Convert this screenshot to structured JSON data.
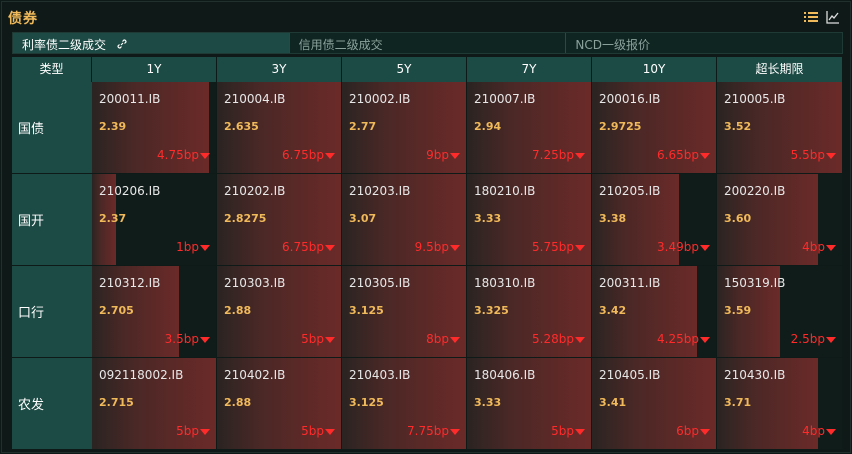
{
  "header": {
    "title": "债券"
  },
  "tabs": [
    {
      "label": "利率债二级成交",
      "active": true
    },
    {
      "label": "信用债二级成交",
      "active": false
    },
    {
      "label": "NCD一级报价",
      "active": false
    }
  ],
  "columns": [
    "类型",
    "1Y",
    "3Y",
    "5Y",
    "7Y",
    "10Y",
    "超长期限"
  ],
  "rows": [
    {
      "label": "国债",
      "cells": [
        {
          "code": "200011.IB",
          "yield": "2.39",
          "change": "4.75bp",
          "fill": 0.94
        },
        {
          "code": "210004.IB",
          "yield": "2.635",
          "change": "6.75bp",
          "fill": 1.0
        },
        {
          "code": "210002.IB",
          "yield": "2.77",
          "change": "9bp",
          "fill": 1.0
        },
        {
          "code": "210007.IB",
          "yield": "2.94",
          "change": "7.25bp",
          "fill": 1.0
        },
        {
          "code": "200016.IB",
          "yield": "2.9725",
          "change": "6.65bp",
          "fill": 1.0
        },
        {
          "code": "210005.IB",
          "yield": "3.52",
          "change": "5.5bp",
          "fill": 1.0
        }
      ]
    },
    {
      "label": "国开",
      "cells": [
        {
          "code": "210206.IB",
          "yield": "2.37",
          "change": "1bp",
          "fill": 0.19
        },
        {
          "code": "210202.IB",
          "yield": "2.8275",
          "change": "6.75bp",
          "fill": 1.0
        },
        {
          "code": "210203.IB",
          "yield": "3.07",
          "change": "9.5bp",
          "fill": 1.0
        },
        {
          "code": "180210.IB",
          "yield": "3.33",
          "change": "5.75bp",
          "fill": 1.0
        },
        {
          "code": "210205.IB",
          "yield": "3.38",
          "change": "3.49bp",
          "fill": 0.7
        },
        {
          "code": "200220.IB",
          "yield": "3.60",
          "change": "4bp",
          "fill": 0.81
        }
      ]
    },
    {
      "label": "口行",
      "cells": [
        {
          "code": "210312.IB",
          "yield": "2.705",
          "change": "3.5bp",
          "fill": 0.7
        },
        {
          "code": "210303.IB",
          "yield": "2.88",
          "change": "5bp",
          "fill": 1.0
        },
        {
          "code": "210305.IB",
          "yield": "3.125",
          "change": "8bp",
          "fill": 1.0
        },
        {
          "code": "180310.IB",
          "yield": "3.325",
          "change": "5.28bp",
          "fill": 1.0
        },
        {
          "code": "200311.IB",
          "yield": "3.42",
          "change": "4.25bp",
          "fill": 0.85
        },
        {
          "code": "150319.IB",
          "yield": "3.59",
          "change": "2.5bp",
          "fill": 0.5
        }
      ]
    },
    {
      "label": "农发",
      "cells": [
        {
          "code": "092118002.IB",
          "yield": "2.715",
          "change": "5bp",
          "fill": 1.0
        },
        {
          "code": "210402.IB",
          "yield": "2.88",
          "change": "5bp",
          "fill": 1.0
        },
        {
          "code": "210403.IB",
          "yield": "3.125",
          "change": "7.75bp",
          "fill": 1.0
        },
        {
          "code": "180406.IB",
          "yield": "3.33",
          "change": "5bp",
          "fill": 1.0
        },
        {
          "code": "210405.IB",
          "yield": "3.41",
          "change": "6bp",
          "fill": 1.0
        },
        {
          "code": "210430.IB",
          "yield": "3.71",
          "change": "4bp",
          "fill": 0.81
        }
      ]
    }
  ],
  "icons": {
    "list": "list-icon",
    "chart": "line-chart-icon",
    "link": "link-icon",
    "down": "down-triangle-icon"
  },
  "colors": {
    "accent": "#f0b95a",
    "down": "#ff2b2b",
    "header": "#1c4a44"
  }
}
